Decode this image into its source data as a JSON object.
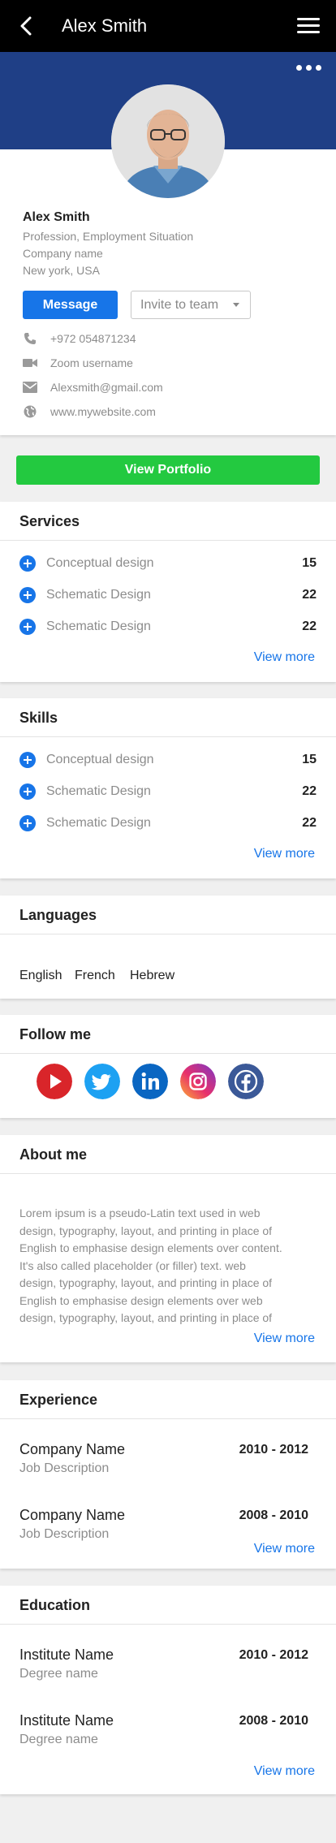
{
  "header": {
    "title": "Alex Smith",
    "back_icon": "chevron-left-icon",
    "menu_icon": "hamburger-menu-icon",
    "more_icon": "more-dots-icon"
  },
  "colors": {
    "header_bg": "#000000",
    "banner_bg": "#1f3f86",
    "primary": "#1775e8",
    "success": "#23c940"
  },
  "profile": {
    "name": "Alex Smith",
    "profession": "Profession, Employment Situation",
    "company": "Company name",
    "location": "New york, USA",
    "message_label": "Message",
    "invite_placeholder": "Invite to team"
  },
  "contacts": [
    {
      "icon": "phone-icon",
      "text": "+972 054871234"
    },
    {
      "icon": "video-camera-icon",
      "text": "Zoom username"
    },
    {
      "icon": "mail-icon",
      "text": "Alexsmith@gmail.com"
    },
    {
      "icon": "globe-icon",
      "text": "www.mywebsite.com"
    }
  ],
  "portfolio_label": "View Portfolio",
  "services": {
    "title": "Services",
    "items": [
      {
        "label": "Conceptual design",
        "count": "15"
      },
      {
        "label": "Schematic Design",
        "count": "22"
      },
      {
        "label": "Schematic Design",
        "count": "22"
      }
    ],
    "view_more": "View more"
  },
  "skills": {
    "title": "Skills",
    "items": [
      {
        "label": "Conceptual design",
        "count": "15"
      },
      {
        "label": "Schematic Design",
        "count": "22"
      },
      {
        "label": "Schematic Design",
        "count": "22"
      }
    ],
    "view_more": "View more"
  },
  "languages": {
    "title": "Languages",
    "items": [
      "English",
      "French",
      "Hebrew"
    ]
  },
  "follow": {
    "title": "Follow me",
    "icons": [
      "youtube-icon",
      "twitter-icon",
      "linkedin-icon",
      "instagram-icon",
      "facebook-icon"
    ]
  },
  "about": {
    "title": "About me",
    "lines": [
      "Lorem ipsum is a pseudo-Latin text used in web",
      "design, typography, layout, and printing in place of",
      "English to emphasise design elements over content.",
      "It's also called placeholder (or filler) text. web",
      "design, typography, layout, and printing in place of",
      "English to emphasise design elements over web",
      "design, typography, layout, and printing in place of"
    ],
    "view_more": "View more"
  },
  "experience": {
    "title": "Experience",
    "items": [
      {
        "name": "Company Name",
        "desc": "Job Description",
        "years": "2010 - 2012"
      },
      {
        "name": "Company Name",
        "desc": "Job Description",
        "years": "2008 - 2010"
      }
    ],
    "view_more": "View more"
  },
  "education": {
    "title": "Education",
    "items": [
      {
        "name": "Institute Name",
        "desc": "Degree name",
        "years": "2010 - 2012"
      },
      {
        "name": "Institute Name",
        "desc": "Degree name",
        "years": "2008 - 2010"
      }
    ],
    "view_more": "View more"
  }
}
